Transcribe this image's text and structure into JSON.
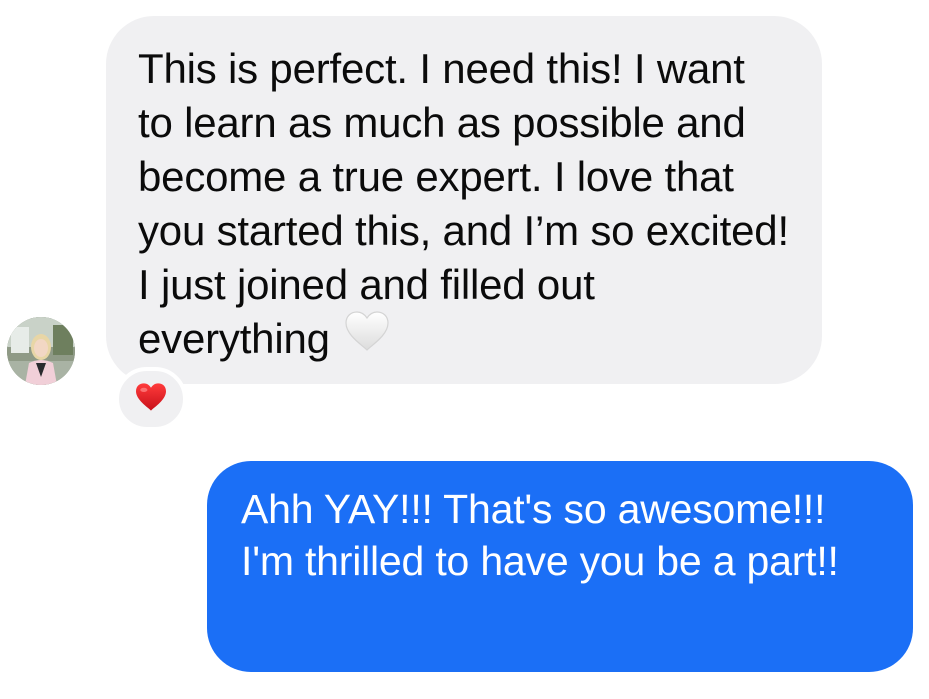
{
  "messages": {
    "incoming": {
      "text": "This is perfect. I need this! I want to learn as much as possible and become a true expert. I love that you started this, and I’m so excited! I just joined and filled out everything",
      "inline_emoji": "white-heart-icon",
      "bubble_color": "#f0f0f2",
      "reaction": "red-heart-icon",
      "reaction_color": "#e0202a"
    },
    "outgoing": {
      "text": "Ahh YAY!!! That's so awesome!!! I'm thrilled to have you be a part!!",
      "bubble_color": "#1b6ff6"
    }
  }
}
